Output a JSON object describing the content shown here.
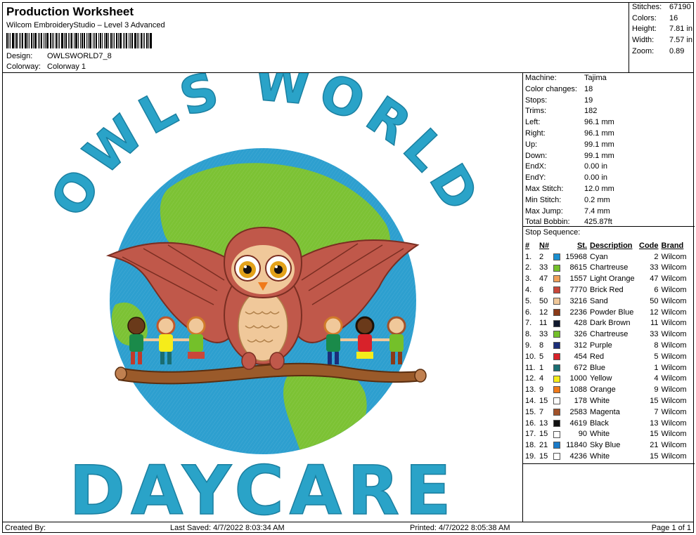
{
  "header": {
    "title": "Production Worksheet",
    "software": "Wilcom EmbroideryStudio – Level 3 Advanced",
    "design_label": "Design:",
    "design_value": "OWLSWORLD7_8",
    "colorway_label": "Colorway:",
    "colorway_value": "Colorway 1"
  },
  "stats": [
    {
      "label": "Stitches:",
      "value": "67190"
    },
    {
      "label": "Colors:",
      "value": "16"
    },
    {
      "label": "Height:",
      "value": "7.81 in"
    },
    {
      "label": "Width:",
      "value": "7.57 in"
    },
    {
      "label": "Zoom:",
      "value": "0.89"
    }
  ],
  "machine_info": [
    {
      "label": "Machine:",
      "value": "Tajima"
    },
    {
      "label": "Color changes:",
      "value": "18"
    },
    {
      "label": "Stops:",
      "value": "19"
    },
    {
      "label": "Trims:",
      "value": "182"
    },
    {
      "label": "Left:",
      "value": "96.1 mm"
    },
    {
      "label": "Right:",
      "value": "96.1 mm"
    },
    {
      "label": "Up:",
      "value": "99.1 mm"
    },
    {
      "label": "Down:",
      "value": "99.1 mm"
    },
    {
      "label": "EndX:",
      "value": "0.00 in"
    },
    {
      "label": "EndY:",
      "value": "0.00 in"
    },
    {
      "label": "Max Stitch:",
      "value": "12.0 mm"
    },
    {
      "label": "Min Stitch:",
      "value": "0.2 mm"
    },
    {
      "label": "Max Jump:",
      "value": "7.4 mm"
    },
    {
      "label": "Total Bobbin:",
      "value": "425.87ft"
    }
  ],
  "stop_sequence": {
    "title": "Stop Sequence:",
    "headers": {
      "idx": "#",
      "n": "N#",
      "st": "St.",
      "desc": "Description",
      "code": "Code",
      "brand": "Brand"
    },
    "rows": [
      {
        "idx": "1.",
        "n": "2",
        "color": "#1a8fd0",
        "st": "15968",
        "desc": "Cyan",
        "code": "2",
        "brand": "Wilcom"
      },
      {
        "idx": "2.",
        "n": "33",
        "color": "#74c02a",
        "st": "8615",
        "desc": "Chartreuse",
        "code": "33",
        "brand": "Wilcom"
      },
      {
        "idx": "3.",
        "n": "47",
        "color": "#f0a05a",
        "st": "1557",
        "desc": "Light Orange",
        "code": "47",
        "brand": "Wilcom"
      },
      {
        "idx": "4.",
        "n": "6",
        "color": "#c9473a",
        "st": "7770",
        "desc": "Brick Red",
        "code": "6",
        "brand": "Wilcom"
      },
      {
        "idx": "5.",
        "n": "50",
        "color": "#f0c89a",
        "st": "3216",
        "desc": "Sand",
        "code": "50",
        "brand": "Wilcom"
      },
      {
        "idx": "6.",
        "n": "12",
        "color": "#8a3a18",
        "st": "2236",
        "desc": "Powder Blue",
        "code": "12",
        "brand": "Wilcom"
      },
      {
        "idx": "7.",
        "n": "11",
        "color": "#10182e",
        "st": "428",
        "desc": "Dark Brown",
        "code": "11",
        "brand": "Wilcom"
      },
      {
        "idx": "8.",
        "n": "33",
        "color": "#74c02a",
        "st": "326",
        "desc": "Chartreuse",
        "code": "33",
        "brand": "Wilcom"
      },
      {
        "idx": "9.",
        "n": "8",
        "color": "#1b2e7a",
        "st": "312",
        "desc": "Purple",
        "code": "8",
        "brand": "Wilcom"
      },
      {
        "idx": "10.",
        "n": "5",
        "color": "#d8222a",
        "st": "454",
        "desc": "Red",
        "code": "5",
        "brand": "Wilcom"
      },
      {
        "idx": "11.",
        "n": "1",
        "color": "#1a6e72",
        "st": "672",
        "desc": "Blue",
        "code": "1",
        "brand": "Wilcom"
      },
      {
        "idx": "12.",
        "n": "4",
        "color": "#f5ec1a",
        "st": "1000",
        "desc": "Yellow",
        "code": "4",
        "brand": "Wilcom"
      },
      {
        "idx": "13.",
        "n": "9",
        "color": "#f07a1a",
        "st": "1088",
        "desc": "Orange",
        "code": "9",
        "brand": "Wilcom"
      },
      {
        "idx": "14.",
        "n": "15",
        "color": "#ffffff",
        "st": "178",
        "desc": "White",
        "code": "15",
        "brand": "Wilcom"
      },
      {
        "idx": "15.",
        "n": "7",
        "color": "#a2522a",
        "st": "2583",
        "desc": "Magenta",
        "code": "7",
        "brand": "Wilcom"
      },
      {
        "idx": "16.",
        "n": "13",
        "color": "#111111",
        "st": "4619",
        "desc": "Black",
        "code": "13",
        "brand": "Wilcom"
      },
      {
        "idx": "17.",
        "n": "15",
        "color": "#ffffff",
        "st": "90",
        "desc": "White",
        "code": "15",
        "brand": "Wilcom"
      },
      {
        "idx": "18.",
        "n": "21",
        "color": "#1a7ac8",
        "st": "11840",
        "desc": "Sky Blue",
        "code": "21",
        "brand": "Wilcom"
      },
      {
        "idx": "19.",
        "n": "15",
        "color": "#ffffff",
        "st": "4236",
        "desc": "White",
        "code": "15",
        "brand": "Wilcom"
      }
    ]
  },
  "design": {
    "top_text": "OWLS WORLD",
    "bottom_text": "DAYCARE",
    "colors": {
      "letters": "#2aa3c8",
      "ocean": "#2d9fcf",
      "land": "#7cc234",
      "owl": "#c0584a",
      "branch": "#9a5a2a"
    }
  },
  "footer": {
    "created": "Created By:",
    "saved": "Last Saved: 4/7/2022 8:03:34 AM",
    "printed": "Printed: 4/7/2022 8:05:38 AM",
    "page": "Page 1 of 1"
  }
}
